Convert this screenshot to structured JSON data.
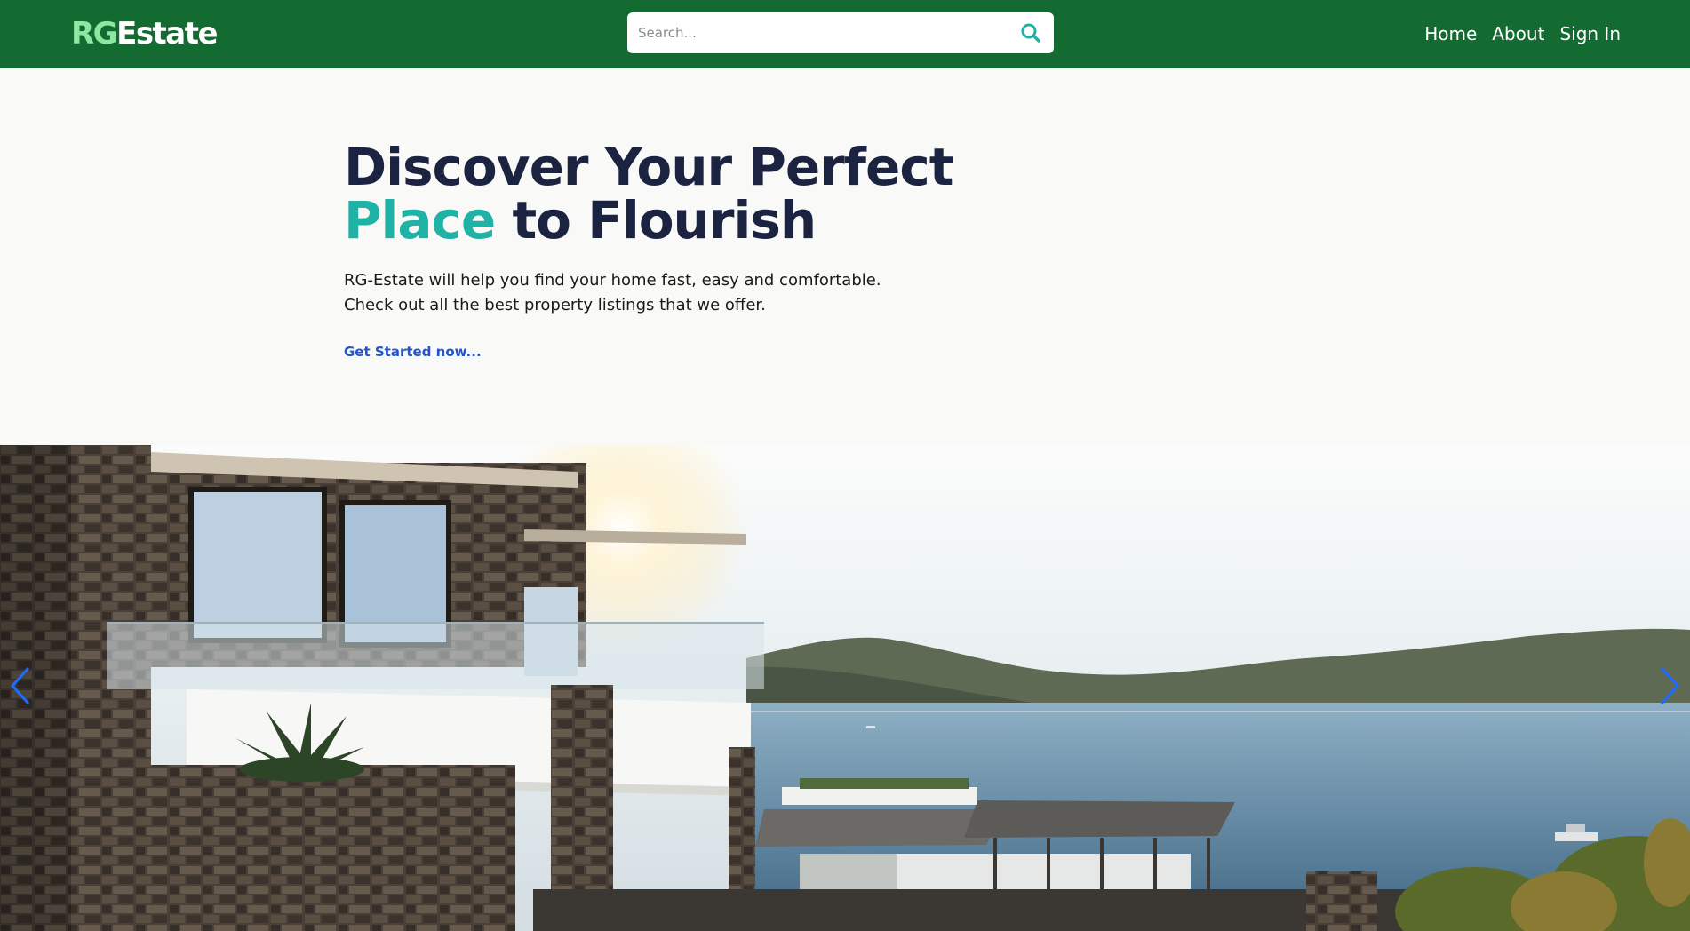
{
  "header": {
    "logo_rg": "RG",
    "logo_estate": "Estate",
    "search_placeholder": "Search...",
    "nav": [
      "Home",
      "About",
      "Sign In"
    ],
    "colors": {
      "background": "#146b31",
      "logo_accent": "#8ee6a0"
    }
  },
  "hero": {
    "title_line1": "Discover Your Perfect",
    "title_accent": "Place",
    "title_rest": " to Flourish",
    "desc_line1": "RG-Estate will help you find your home fast, easy and comfortable.",
    "desc_line2": "Check out all the best property listings that we offer.",
    "cta": "Get Started now...",
    "colors": {
      "title": "#1c2340",
      "accent": "#20b2a4",
      "link": "#2255cc"
    }
  },
  "carousel": {
    "prev_icon": "chevron-left-icon",
    "next_icon": "chevron-right-icon"
  }
}
